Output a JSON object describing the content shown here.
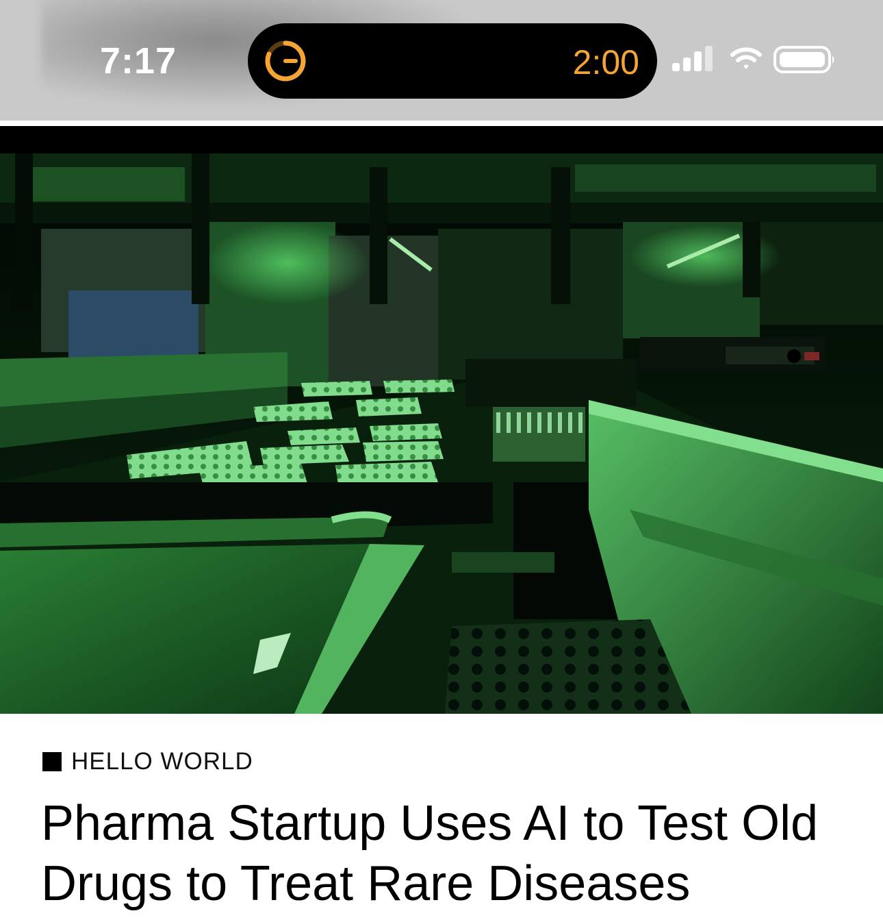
{
  "status_bar": {
    "time": "7:17",
    "timer": "2:00",
    "icons": [
      "timer-icon",
      "cellular-signal-icon",
      "wifi-icon",
      "battery-icon"
    ],
    "colors": {
      "timer": "#f4a534",
      "bar_background": "#c9c9c9"
    }
  },
  "hero_image": {
    "description_icon": "lab-robotics-photo",
    "accent_color": "#3cff5a"
  },
  "article": {
    "kicker": "HELLO WORLD",
    "headline": "Pharma Startup Uses AI to Test Old Drugs to Treat Rare Diseases"
  }
}
